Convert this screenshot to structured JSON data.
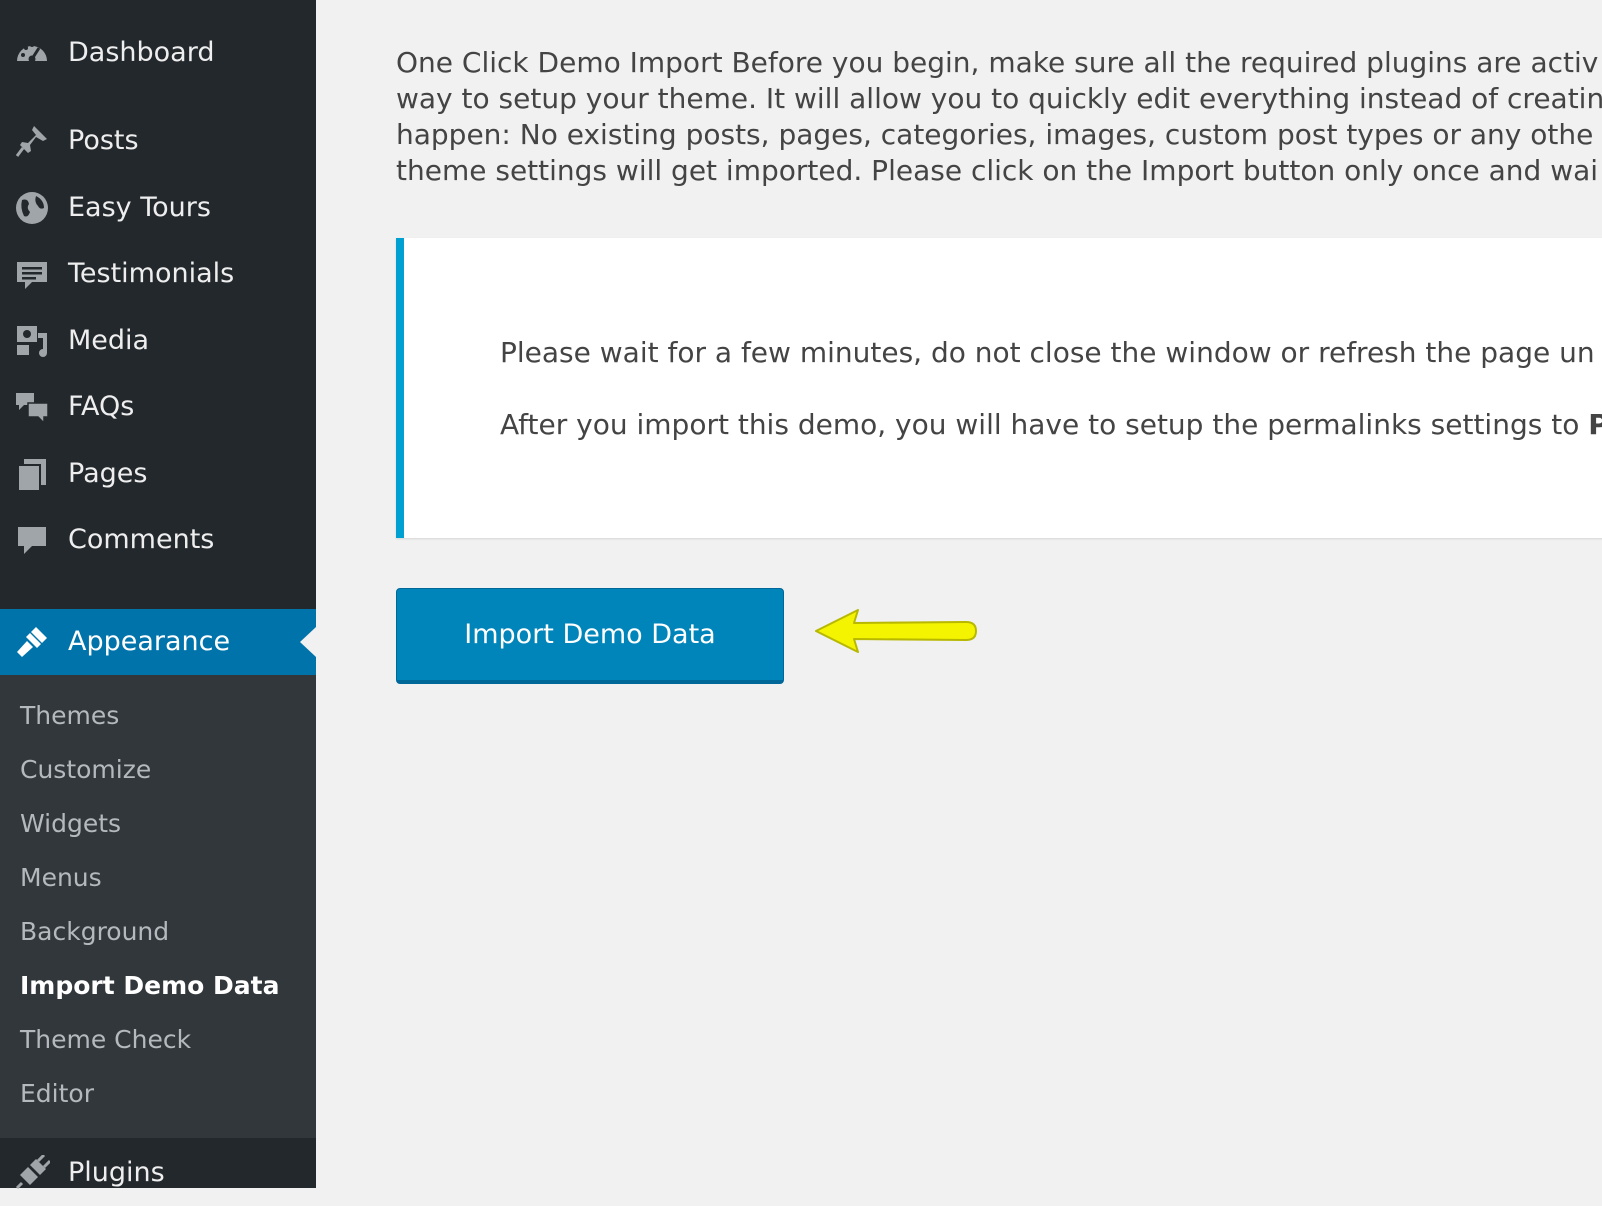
{
  "sidebar": {
    "menu": [
      {
        "label": "Dashboard",
        "icon": "dashboard-icon"
      },
      {
        "label": "Posts",
        "icon": "pin-icon"
      },
      {
        "label": "Easy Tours",
        "icon": "globe-icon"
      },
      {
        "label": "Testimonials",
        "icon": "testimonial-icon"
      },
      {
        "label": "Media",
        "icon": "media-icon"
      },
      {
        "label": "FAQs",
        "icon": "faq-icon"
      },
      {
        "label": "Pages",
        "icon": "pages-icon"
      },
      {
        "label": "Comments",
        "icon": "comment-icon"
      },
      {
        "label": "Appearance",
        "icon": "paintbrush-icon",
        "current": true
      },
      {
        "label": "Plugins",
        "icon": "plugin-icon"
      }
    ],
    "submenu": [
      {
        "label": "Themes"
      },
      {
        "label": "Customize"
      },
      {
        "label": "Widgets"
      },
      {
        "label": "Menus"
      },
      {
        "label": "Background"
      },
      {
        "label": "Import Demo Data",
        "current": true
      },
      {
        "label": "Theme Check"
      },
      {
        "label": "Editor"
      }
    ]
  },
  "main": {
    "intro_lines": [
      "One Click Demo Import Before you begin, make sure all the required plugins are activ",
      "way to setup your theme. It will allow you to quickly edit everything instead of creatin",
      "happen: No existing posts, pages, categories, images, custom post types or any othe",
      "theme settings will get imported. Please click on the Import button only once and wai"
    ],
    "notice": {
      "line1": "Please wait for a few minutes, do not close the window or refresh the page un",
      "line2_prefix": "After you import this demo, you will have to setup the permalinks settings to ",
      "line2_bold": "P"
    },
    "import_button_label": "Import Demo Data"
  },
  "colors": {
    "sidebar_bg": "#23282d",
    "submenu_bg": "#32373c",
    "accent": "#0073aa",
    "button": "#0085ba",
    "notice_border": "#00a0d2",
    "arrow": "#f4f400"
  }
}
